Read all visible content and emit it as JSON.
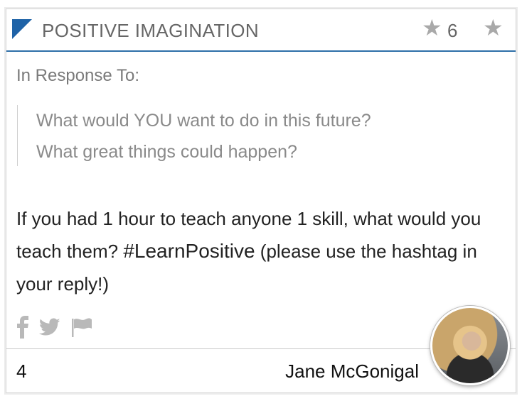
{
  "card": {
    "category": "POSITIVE IMAGINATION",
    "star_count": "6",
    "response_label": "In Response To:",
    "quote_lines": [
      "What would YOU want to do in this future?",
      "What great things could happen?"
    ],
    "body": {
      "part1": "If you had 1 hour to teach anyone 1 skill, what would you teach them?",
      "hashtag": "#LearnPositive",
      "part2": "(please use the hashtag in your reply!)"
    },
    "footer": {
      "count": "4",
      "author": "Jane McGonigal"
    }
  },
  "icons": [
    "star-icon",
    "facebook-icon",
    "twitter-icon",
    "flag-icon"
  ],
  "colors": {
    "accent": "#1f63a7",
    "header_line": "#2e6fa8",
    "muted_text": "#666666",
    "icon_gray": "#a9a9a9"
  }
}
